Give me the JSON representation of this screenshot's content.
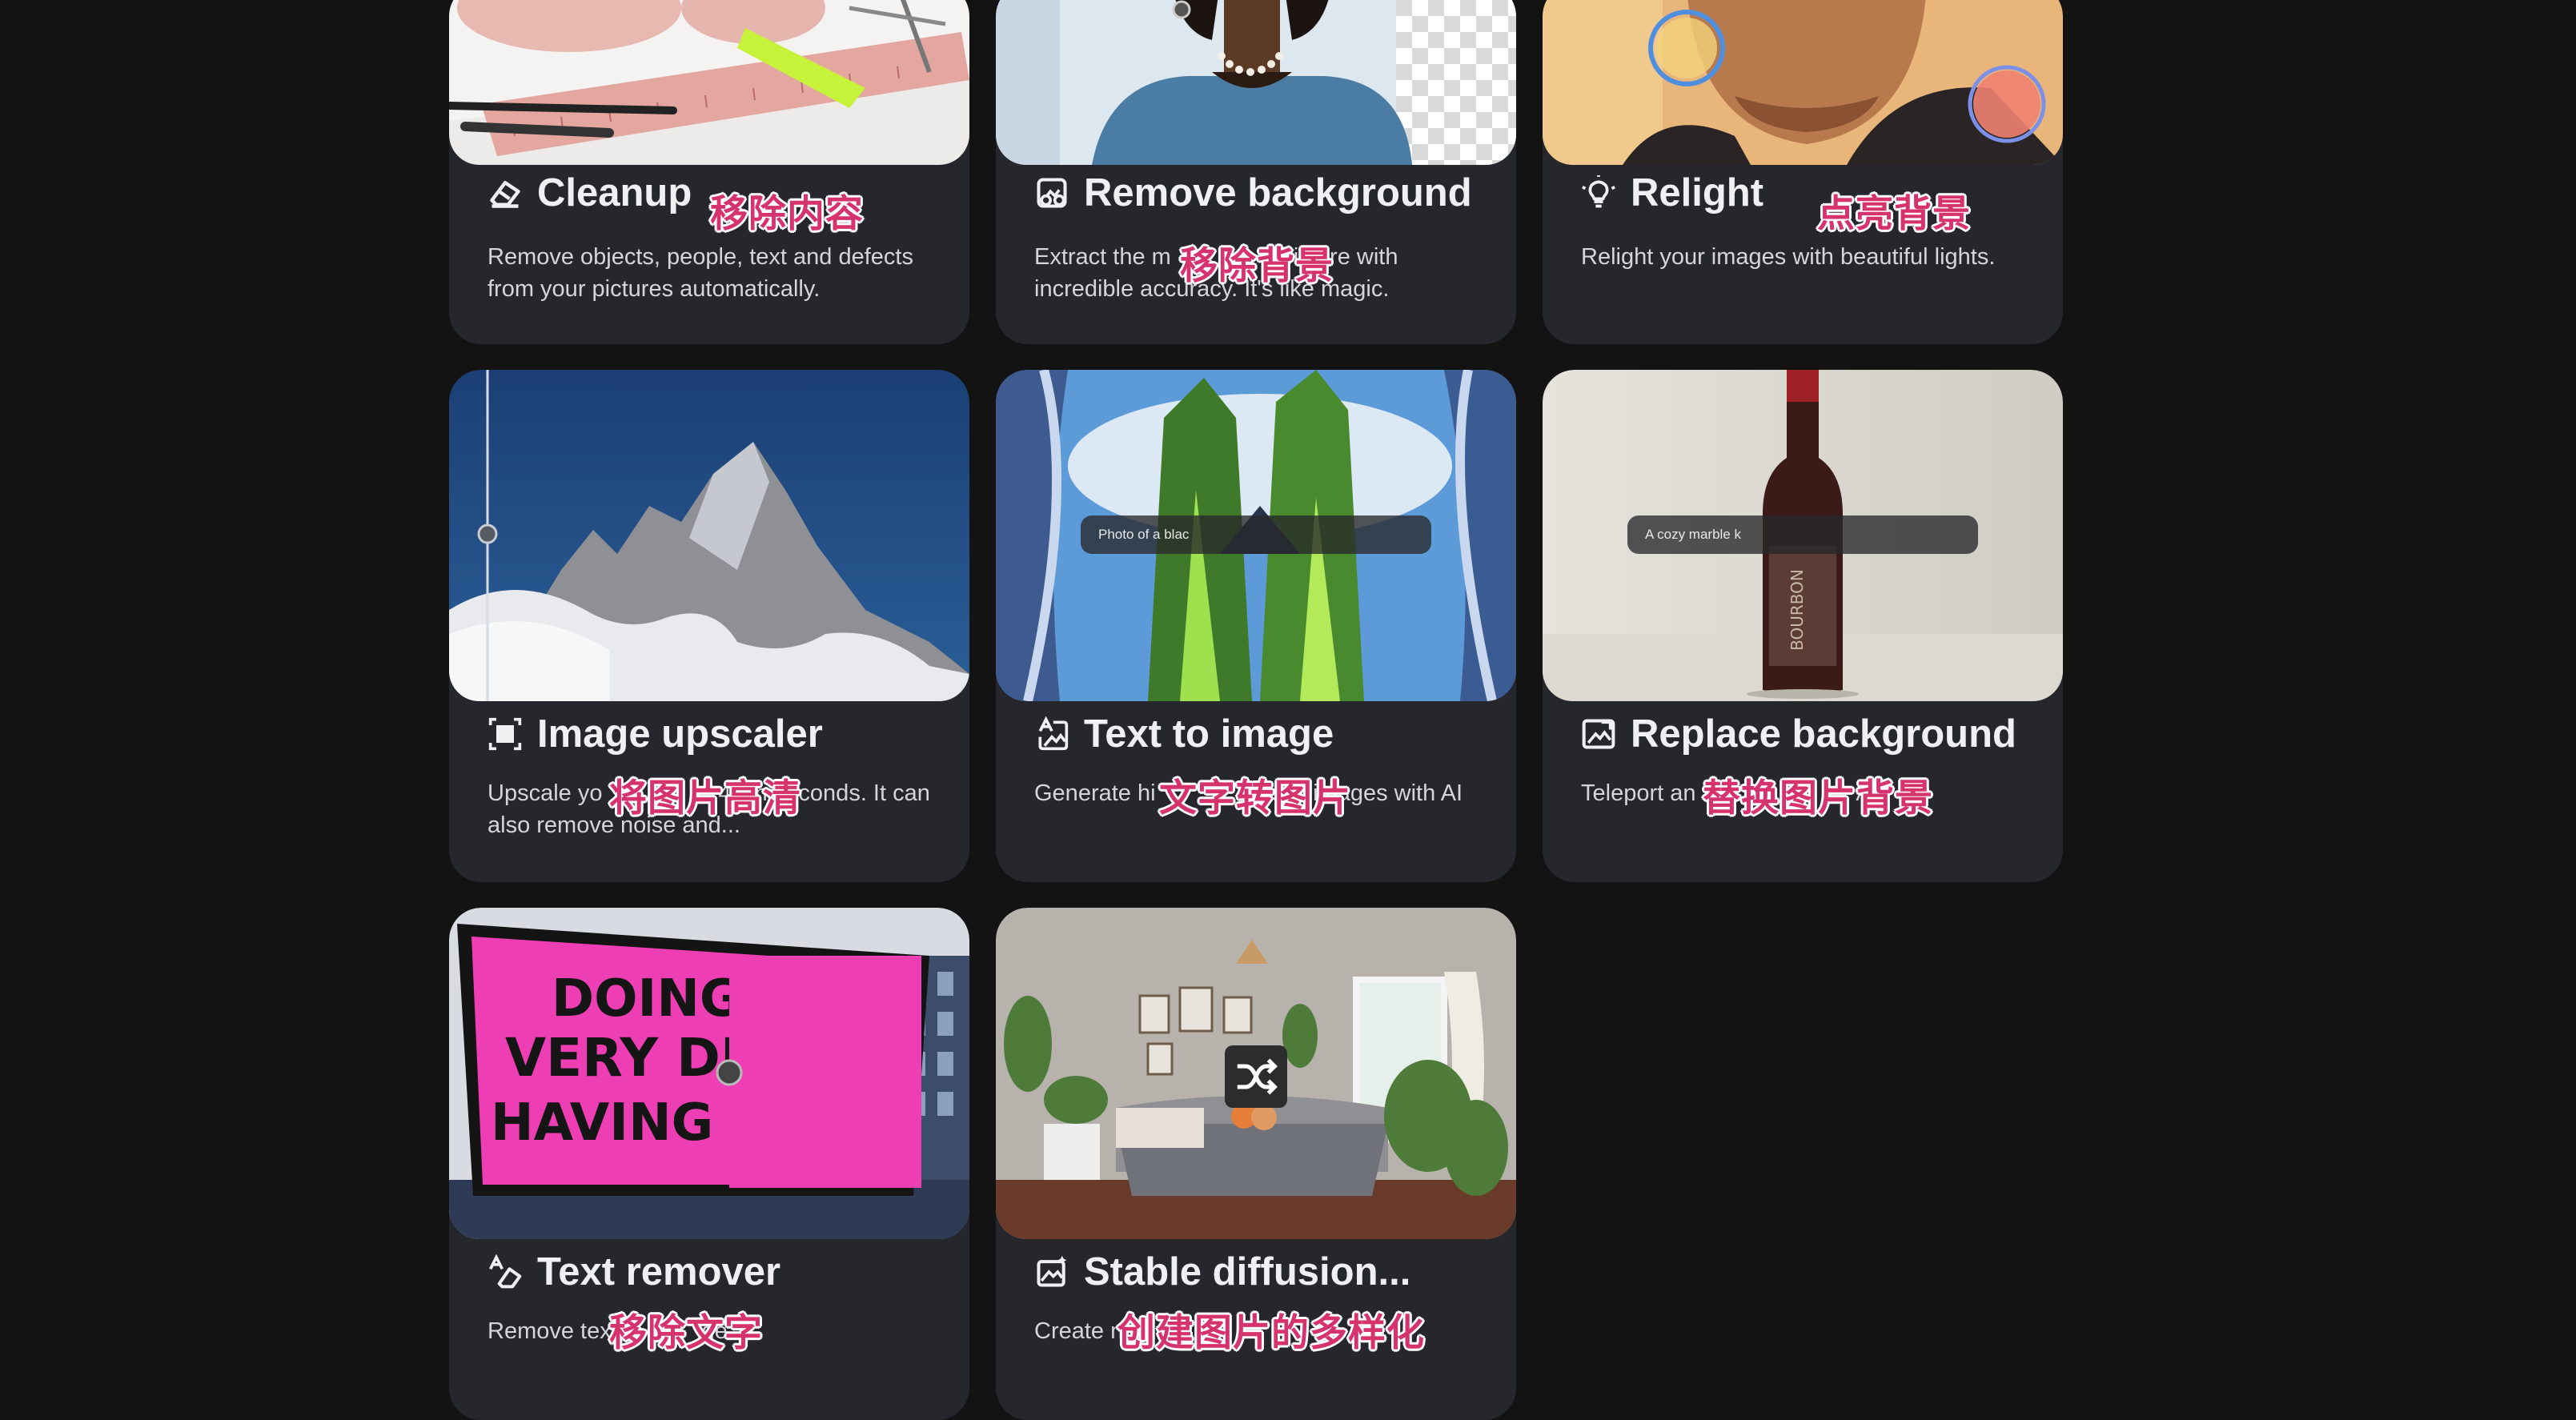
{
  "cards": [
    {
      "title": "Cleanup",
      "icon": "eraser-icon",
      "desc": "Remove objects, people, text and defects from your pictures automatically.",
      "cn": "移除内容"
    },
    {
      "title": "Remove background",
      "icon": "background-remove-icon",
      "desc": "Extract the m          m a picture with incredible accuracy. It's like magic.",
      "cn": "移除背景"
    },
    {
      "title": "Relight",
      "icon": "light-bulb-icon",
      "desc": "Relight your images with beautiful lights.",
      "cn": "点亮背景"
    },
    {
      "title": "Image upscaler",
      "icon": "upscale-icon",
      "desc": "Upscale yo                  4x in seconds. It can also remove noise and...",
      "cn": "将图片高清"
    },
    {
      "title": "Text to image",
      "icon": "text-image-icon",
      "desc": "Generate hi                  stic images with AI",
      "cn": "文字转图片",
      "prompt": "Photo of a blac"
    },
    {
      "title": "Replace background",
      "icon": "replace-image-icon",
      "desc": "Teleport an                         AI",
      "cn": "替换图片背景",
      "prompt": "A cozy marble k"
    },
    {
      "title": "Text remover",
      "icon": "text-eraser-icon",
      "desc": "Remove tex              ge",
      "cn": "移除文字",
      "billboard": [
        "DOING NC",
        "VERY DIFFE",
        "HAVING NOT"
      ]
    },
    {
      "title": "Stable diffusion...",
      "icon": "image-sparkle-icon",
      "desc": "Create n",
      "cn": "创建图片的多样化"
    }
  ],
  "colors": {
    "page_bg": "#131313",
    "card_bg": "#26262d",
    "annotation": "#d6336c"
  }
}
